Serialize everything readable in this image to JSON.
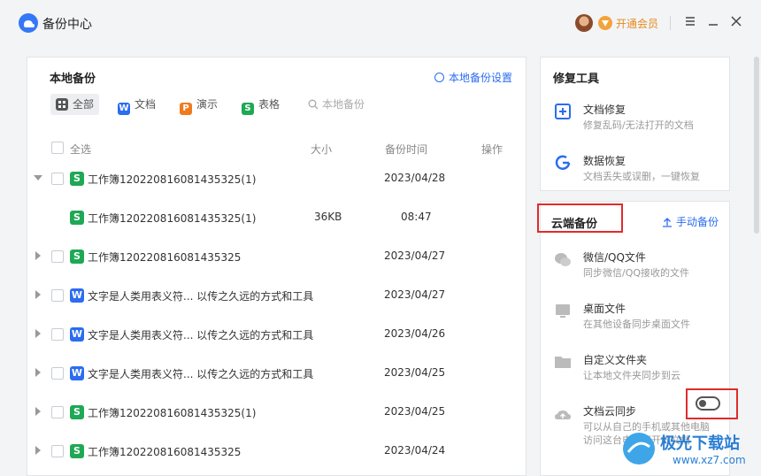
{
  "app": {
    "title": "备份中心"
  },
  "header": {
    "vip_label": "开通会员"
  },
  "local": {
    "title": "本地备份",
    "settings_label": "本地备份设置",
    "filters": [
      {
        "label": "全部",
        "icon": "grid-icon"
      },
      {
        "label": "文档",
        "icon": "W"
      },
      {
        "label": "演示",
        "icon": "P"
      },
      {
        "label": "表格",
        "icon": "S"
      },
      {
        "label": "本地备份",
        "icon": "search-icon"
      }
    ],
    "columns": {
      "select_all": "全选",
      "size": "大小",
      "time": "备份时间",
      "action": "操作"
    },
    "rows": [
      {
        "icon": "S",
        "name": "工作簿120220816081435325(1)",
        "size": "",
        "time": "2023/04/28",
        "expander": "open"
      },
      {
        "icon": "S",
        "name": "工作簿120220816081435325(1)",
        "size": "36KB",
        "time": "08:47",
        "expander": "none"
      },
      {
        "icon": "S",
        "name": "工作簿120220816081435325",
        "size": "",
        "time": "2023/04/27",
        "expander": "closed"
      },
      {
        "icon": "W",
        "name": "文字是人类用表义符... 以传之久远的方式和工具",
        "size": "",
        "time": "2023/04/27",
        "expander": "closed"
      },
      {
        "icon": "W",
        "name": "文字是人类用表义符... 以传之久远的方式和工具",
        "size": "",
        "time": "2023/04/26",
        "expander": "closed"
      },
      {
        "icon": "W",
        "name": "文字是人类用表义符... 以传之久远的方式和工具",
        "size": "",
        "time": "2023/04/25",
        "expander": "closed"
      },
      {
        "icon": "S",
        "name": "工作簿120220816081435325(1)",
        "size": "",
        "time": "2023/04/25",
        "expander": "closed"
      },
      {
        "icon": "S",
        "name": "工作簿120220816081435325",
        "size": "",
        "time": "2023/04/24",
        "expander": "closed"
      }
    ]
  },
  "repair": {
    "title": "修复工具",
    "items": [
      {
        "title": "文档修复",
        "desc": "修复乱码/无法打开的文档",
        "icon": "doc-repair-icon"
      },
      {
        "title": "数据恢复",
        "desc": "文档丢失或误删，一键恢复",
        "icon": "data-recovery-icon"
      }
    ]
  },
  "cloud": {
    "title": "云端备份",
    "manual_label": "手动备份",
    "items": [
      {
        "title": "微信/QQ文件",
        "desc": "同步微信/QQ接收的文件",
        "icon": "chat-icon"
      },
      {
        "title": "桌面文件",
        "desc": "在其他设备同步桌面文件",
        "icon": "desktop-icon"
      },
      {
        "title": "自定义文件夹",
        "desc": "让本地文件夹同步到云",
        "icon": "folder-icon"
      },
      {
        "title": "文档云同步",
        "desc": "可以从自己的手机或其他电脑",
        "desc2": "访问这台电脑打开的文档",
        "icon": "cloud-upload-icon",
        "enabled": false
      }
    ]
  },
  "watermark": {
    "text": "极光下载站",
    "url": "www.xz7.com"
  }
}
